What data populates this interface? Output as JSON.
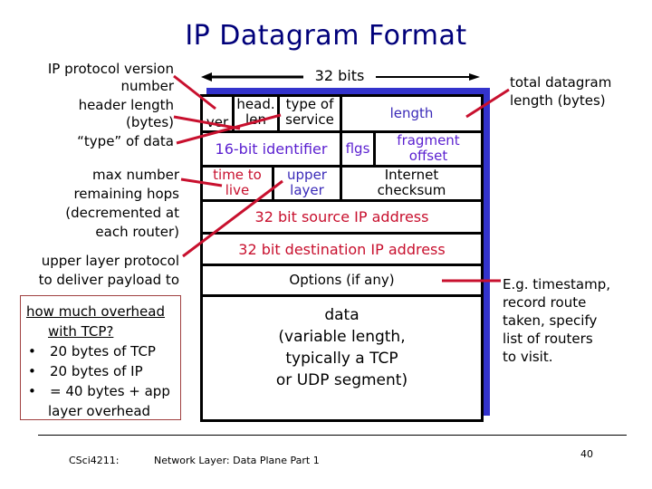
{
  "title": "IP Datagram Format",
  "width_label": "32 bits",
  "left_annotations": {
    "version": "IP protocol version\nnumber",
    "header_length": "header length\n(bytes)",
    "type_of_data": "“type” of data",
    "ttl": "max number\nremaining hops\n(decremented at \neach router)",
    "upper_layer": "upper layer protocol\nto deliver payload to"
  },
  "right_annotations": {
    "total_length": "total datagram\nlength (bytes)",
    "options": "E.g. timestamp,\nrecord route\ntaken, specify\nlist of routers\nto visit."
  },
  "fields": {
    "ver": "ver",
    "head_len": "head.\nlen",
    "type_of_service": "type of\nservice",
    "length": "length",
    "identifier": "16-bit identifier",
    "flags": "flgs",
    "fragment_offset": "fragment\noffset",
    "ttl": "time to\nlive",
    "upper_layer": "upper\nlayer",
    "checksum": "Internet\nchecksum",
    "source": "32 bit source IP address",
    "destination": "32 bit destination IP address",
    "options": "Options (if any)",
    "data": "data\n(variable length,\ntypically a TCP\nor UDP segment)"
  },
  "overhead_box": {
    "question_line1": "how much overhead",
    "question_line2": "with TCP?",
    "bullets": [
      "20 bytes of TCP",
      "20 bytes of IP",
      "= 40 bytes + app"
    ],
    "continuation": "layer overhead",
    "bullet_glyph": "•"
  },
  "footer": {
    "course": "CSci4211:",
    "lecture": "Network Layer: Data Plane Part 1",
    "page": "40"
  },
  "colors": {
    "title": "#00007a",
    "shadow": "#3333cc",
    "pointer": "#c8102e",
    "field_blue": "#3a2ab8",
    "field_purple": "#5a1fd0",
    "field_red": "#c8102e"
  }
}
